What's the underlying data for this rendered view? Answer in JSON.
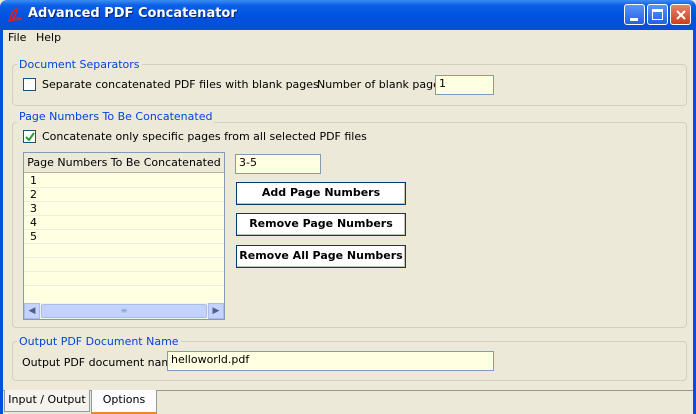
{
  "window": {
    "title": "Advanced PDF Concatenator"
  },
  "menu": {
    "file": "File",
    "help": "Help"
  },
  "separators": {
    "legend": "Document Separators",
    "checkbox_label": "Separate concatenated PDF files with blank pages",
    "checked": false,
    "blank_pages_label": "Number of blank pages:",
    "blank_pages_value": "1"
  },
  "pages": {
    "legend": "Page Numbers To Be Concatenated",
    "checkbox_label": "Concatenate only specific pages from all selected PDF files",
    "checked": true,
    "list_header": "Page Numbers To Be Concatenated",
    "list_items": [
      "1",
      "2",
      "3",
      "4",
      "5"
    ],
    "input_value": "3-5",
    "add_button": "Add Page Numbers",
    "remove_button": "Remove Page Numbers",
    "remove_all_button": "Remove All Page Numbers"
  },
  "output": {
    "legend": "Output PDF Document Name",
    "label": "Output PDF document name:",
    "value": "helloworld.pdf"
  },
  "tabs": [
    "Input / Output",
    "Options"
  ],
  "active_tab": "Options",
  "icons": {
    "app": "pdf-icon",
    "minimize": "minimize-icon",
    "maximize": "maximize-icon",
    "close": "close-icon",
    "scroll_left": "chevron-left-icon",
    "scroll_right": "chevron-right-icon"
  }
}
